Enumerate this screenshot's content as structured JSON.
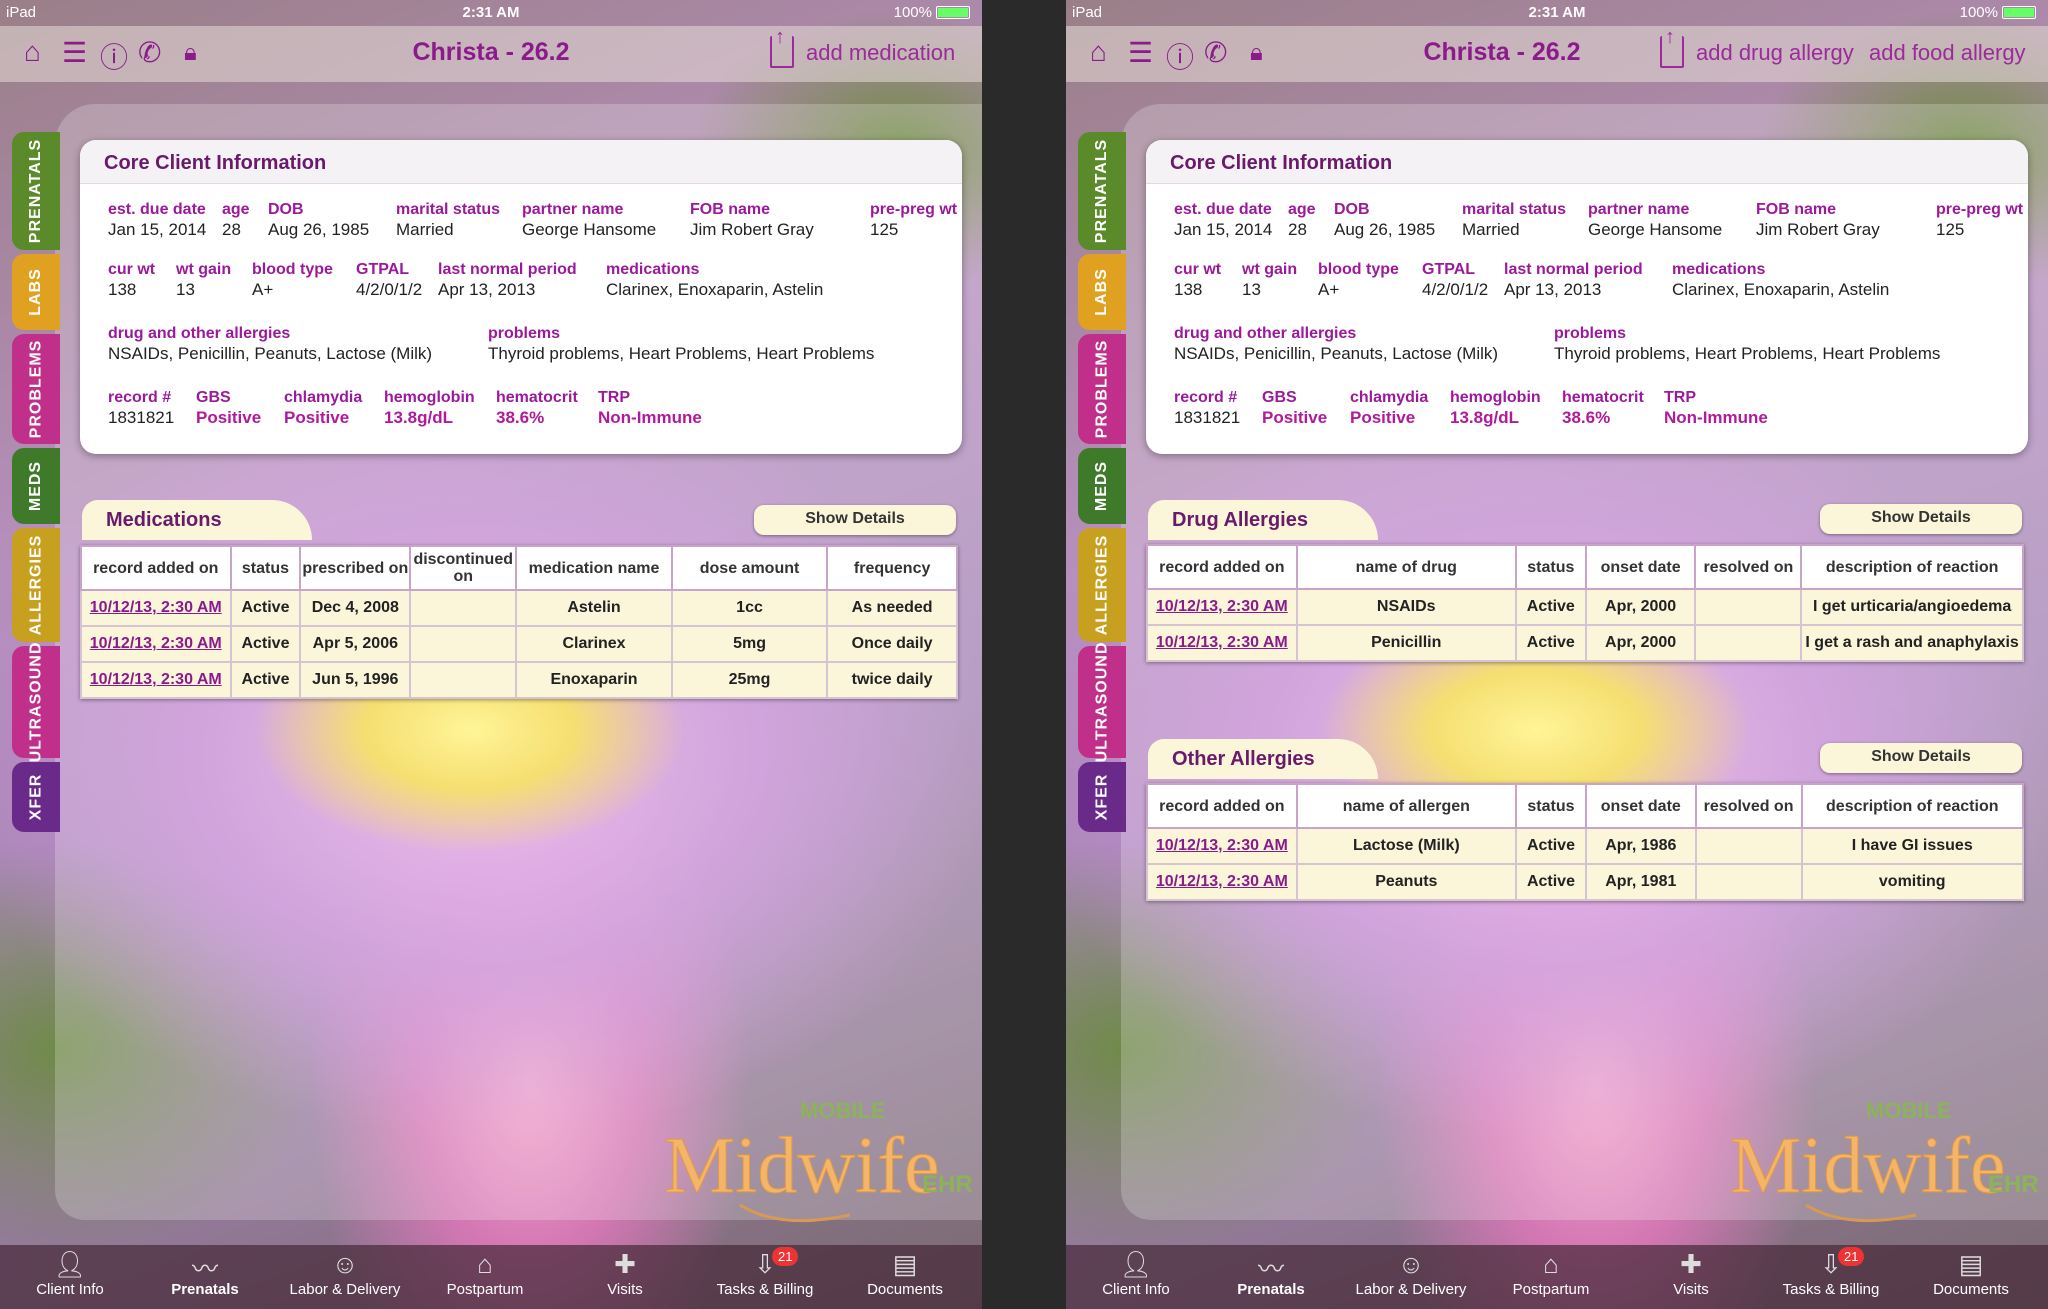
{
  "status_bar": {
    "carrier": "iPad",
    "time": "2:31 AM",
    "battery": "100%"
  },
  "nav": {
    "title": "Christa - 26.2",
    "icons": [
      "home-icon",
      "list-icon",
      "info-icon",
      "phone-icon",
      "lock-icon"
    ],
    "left_action": "add medication",
    "right_actions": [
      "add drug allergy",
      "add food allergy"
    ]
  },
  "side_tabs": [
    {
      "label": "PRENATALS",
      "color": "#5a8a2a"
    },
    {
      "label": "LABS",
      "color": "#e0a020"
    },
    {
      "label": "PROBLEMS",
      "color": "#c0308a"
    },
    {
      "label": "MEDS",
      "color": "#3e7a2a"
    },
    {
      "label": "ALLERGIES",
      "color": "#c8a020"
    },
    {
      "label": "ULTRASOUND",
      "color": "#c0308a"
    },
    {
      "label": "XFER",
      "color": "#6a2a8a"
    }
  ],
  "core": {
    "title": "Core Client Information",
    "row1": [
      {
        "label": "est. due date",
        "value": "Jan 15, 2014"
      },
      {
        "label": "age",
        "value": "28"
      },
      {
        "label": "DOB",
        "value": "Aug 26, 1985"
      },
      {
        "label": "marital status",
        "value": "Married"
      },
      {
        "label": "partner name",
        "value": "George Hansome"
      },
      {
        "label": "FOB name",
        "value": "Jim Robert Gray"
      },
      {
        "label": "pre-preg wt",
        "value": "125"
      }
    ],
    "row2": [
      {
        "label": "cur wt",
        "value": "138"
      },
      {
        "label": "wt gain",
        "value": "13"
      },
      {
        "label": "blood type",
        "value": "A+"
      },
      {
        "label": "GTPAL",
        "value": "4/2/0/1/2"
      },
      {
        "label": "last normal period",
        "value": "Apr 13, 2013"
      },
      {
        "label": "medications",
        "value": "Clarinex, Enoxaparin, Astelin"
      }
    ],
    "row3": [
      {
        "label": "drug and other allergies",
        "value": "NSAIDs, Penicillin, Peanuts, Lactose (Milk)"
      },
      {
        "label": "problems",
        "value": "Thyroid problems, Heart Problems, Heart Problems"
      }
    ],
    "row4": [
      {
        "label": "record #",
        "value": "1831821"
      },
      {
        "label": "GBS",
        "value": "Positive"
      },
      {
        "label": "chlamydia",
        "value": "Positive"
      },
      {
        "label": "hemoglobin",
        "value": "13.8g/dL"
      },
      {
        "label": "hematocrit",
        "value": "38.6%"
      },
      {
        "label": "TRP",
        "value": "Non-Immune"
      }
    ]
  },
  "show_details": "Show Details",
  "medications": {
    "title": "Medications",
    "columns": [
      "record added on",
      "status",
      "prescribed on",
      "discontinued on",
      "medication name",
      "dose amount",
      "frequency"
    ],
    "rows": [
      [
        "10/12/13, 2:30 AM",
        "Active",
        "Dec 4, 2008",
        "",
        "Astelin",
        "1cc",
        "As needed"
      ],
      [
        "10/12/13, 2:30 AM",
        "Active",
        "Apr 5, 2006",
        "",
        "Clarinex",
        "5mg",
        "Once daily"
      ],
      [
        "10/12/13, 2:30 AM",
        "Active",
        "Jun 5, 1996",
        "",
        "Enoxaparin",
        "25mg",
        "twice daily"
      ]
    ]
  },
  "drug_allergies": {
    "title": "Drug Allergies",
    "columns": [
      "record added on",
      "name of drug",
      "status",
      "onset date",
      "resolved on",
      "description of reaction"
    ],
    "rows": [
      [
        "10/12/13, 2:30 AM",
        "NSAIDs",
        "Active",
        "Apr, 2000",
        "",
        "I get urticaria/angioedema"
      ],
      [
        "10/12/13, 2:30 AM",
        "Penicillin",
        "Active",
        "Apr, 2000",
        "",
        "I get a rash and anaphylaxis"
      ]
    ]
  },
  "other_allergies": {
    "title": "Other Allergies",
    "columns": [
      "record added on",
      "name of allergen",
      "status",
      "onset date",
      "resolved on",
      "description of reaction"
    ],
    "rows": [
      [
        "10/12/13, 2:30 AM",
        "Lactose (Milk)",
        "Active",
        "Apr, 1986",
        "",
        "I have GI issues"
      ],
      [
        "10/12/13, 2:30 AM",
        "Peanuts",
        "Active",
        "Apr, 1981",
        "",
        "vomiting"
      ]
    ]
  },
  "logo": {
    "top": "MOBILE",
    "main": "Midwife",
    "suffix": "EHR"
  },
  "tab_bar": [
    {
      "label": "Client Info",
      "icon": "person-icon"
    },
    {
      "label": "Prenatals",
      "icon": "heartbeat-icon",
      "active": true
    },
    {
      "label": "Labor & Delivery",
      "icon": "baby-icon"
    },
    {
      "label": "Postpartum",
      "icon": "house-icon"
    },
    {
      "label": "Visits",
      "icon": "medkit-icon"
    },
    {
      "label": "Tasks & Billing",
      "icon": "inbox-icon",
      "badge": "21"
    },
    {
      "label": "Documents",
      "icon": "cabinet-icon"
    }
  ]
}
